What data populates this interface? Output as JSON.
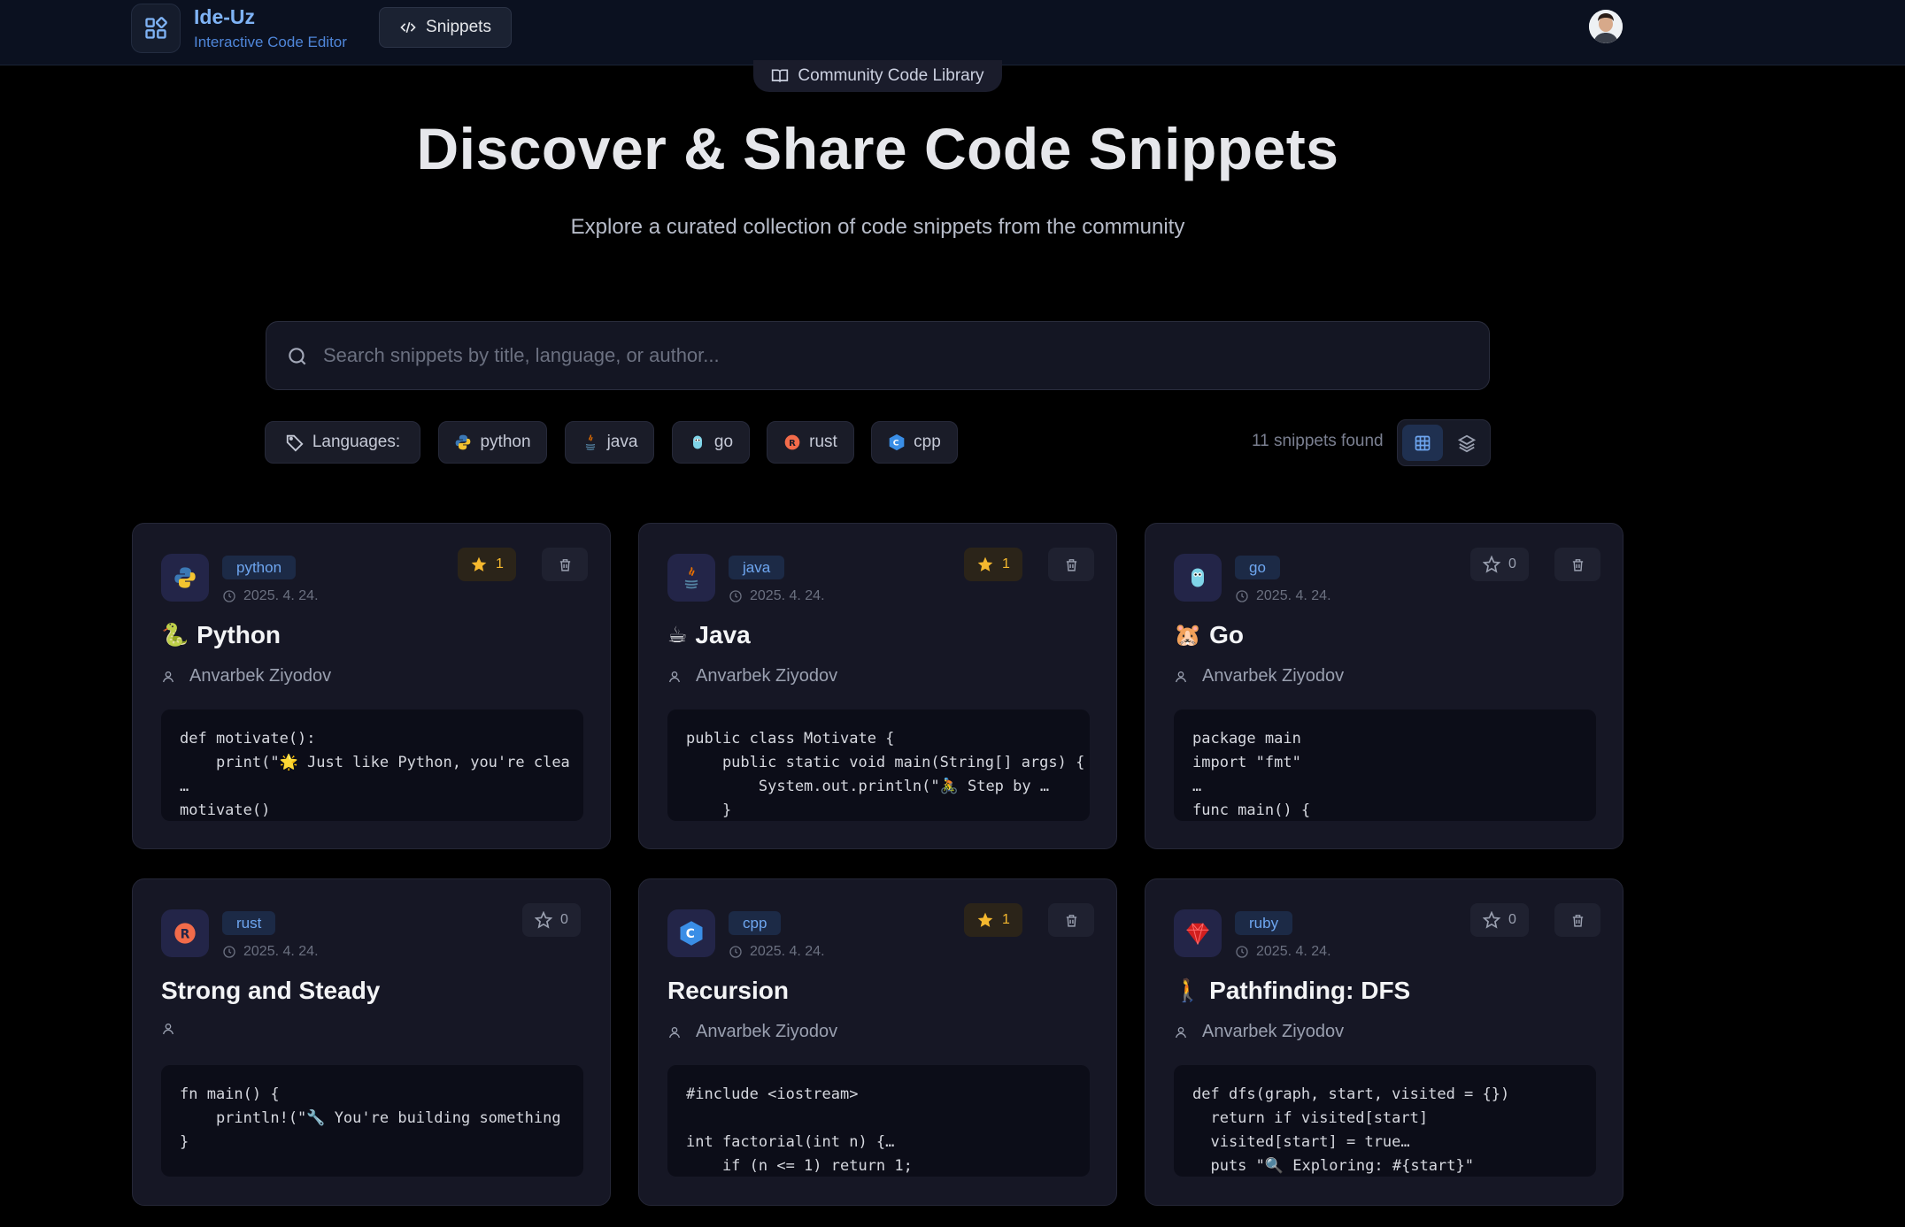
{
  "app": {
    "name": "Ide-Uz",
    "subtitle": "Interactive Code Editor",
    "nav_snippets": "Snippets"
  },
  "hero": {
    "badge": "Community Code Library",
    "title": "Discover & Share Code Snippets",
    "subtitle": "Explore a curated collection of code snippets from the community"
  },
  "search": {
    "placeholder": "Search snippets by title, language, or author..."
  },
  "filters": {
    "label": "Languages:",
    "languages": [
      "python",
      "java",
      "go",
      "rust",
      "cpp"
    ]
  },
  "results": {
    "count_text": "11 snippets found"
  },
  "colors": {
    "background": "#000000",
    "card": "#161725",
    "accent": "#6ea6f0",
    "star": "#f5b82e"
  },
  "cards": [
    {
      "language": "python",
      "date": "2025. 4. 24.",
      "stars": "1",
      "starred": true,
      "title_emoji": "🐍",
      "title": "Python",
      "author": "Anvarbek Ziyodov",
      "code": "def motivate():\n    print(\"🌟 Just like Python, you're clea\n…\nmotivate()"
    },
    {
      "language": "java",
      "date": "2025. 4. 24.",
      "stars": "1",
      "starred": true,
      "title_emoji": "☕",
      "title": "Java",
      "author": "Anvarbek Ziyodov",
      "code": "public class Motivate {\n    public static void main(String[] args) {\n        System.out.println(\"🚴 Step by …\n    }"
    },
    {
      "language": "go",
      "date": "2025. 4. 24.",
      "stars": "0",
      "starred": false,
      "title_emoji": "🐹",
      "title": "Go",
      "author": "Anvarbek Ziyodov",
      "code": "package main\nimport \"fmt\"\n…\nfunc main() {"
    },
    {
      "language": "rust",
      "date": "2025. 4. 24.",
      "stars": "0",
      "starred": false,
      "title_emoji": "",
      "title": "Strong and Steady",
      "author": "",
      "code": "fn main() {\n    println!(\"🔧 You're building something\n}"
    },
    {
      "language": "cpp",
      "date": "2025. 4. 24.",
      "stars": "1",
      "starred": true,
      "title_emoji": "",
      "title": "Recursion",
      "author": "Anvarbek Ziyodov",
      "code": "#include <iostream>\n\nint factorial(int n) {…\n    if (n <= 1) return 1;"
    },
    {
      "language": "ruby",
      "date": "2025. 4. 24.",
      "stars": "0",
      "starred": false,
      "title_emoji": "🚶",
      "title": "Pathfinding: DFS",
      "author": "Anvarbek Ziyodov",
      "code": "def dfs(graph, start, visited = {})\n  return if visited[start]\n  visited[start] = true…\n  puts \"🔍 Exploring: #{start}\""
    }
  ]
}
